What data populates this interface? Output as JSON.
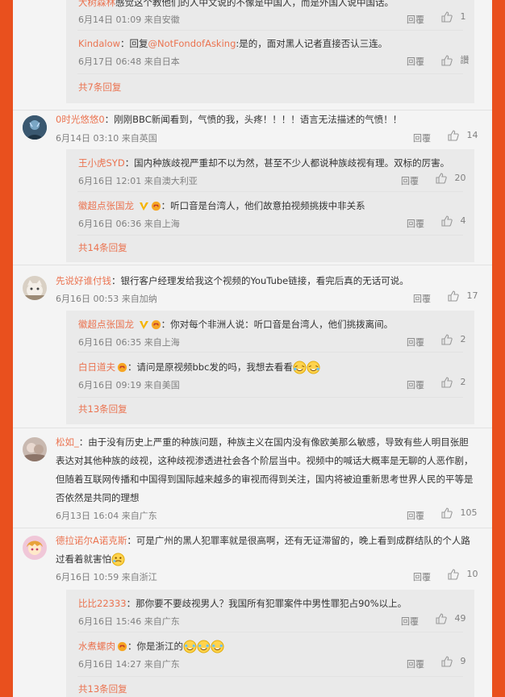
{
  "comments": [
    {
      "partial_text": "感觉这个教他们的人中文说的不像是中国人，而是外国人说中国话。",
      "partial_user": "大树森林",
      "partial_time": "6月14日 01:09 来自安徽",
      "partial_reply": "回覆",
      "partial_likes": "1",
      "replies": [
        {
          "user": "Kindalow",
          "mention": "@NotFondofAsking",
          "text": ":是的，面对黑人记者直接否认三连。",
          "prefix": "：回复",
          "time": "6月17日 06:48 来自日本",
          "reply": "回覆",
          "likes": "讚"
        }
      ],
      "more": "共7条回复"
    },
    {
      "user": "0时光悠悠0",
      "text": "：刚刚BBC新闻看到，气愤的我，头疼！！！！语言无法描述的气愤！！",
      "time": "6月14日 03:10 来自英国",
      "reply": "回覆",
      "likes": "14",
      "replies": [
        {
          "user": "王小虎SYD",
          "text": "：国内种族歧视严重却不以为然，甚至不少人都说种族歧视有理。双标的厉害。",
          "time": "6月16日 12:01 来自澳大利亚",
          "reply": "回覆",
          "likes": "20"
        },
        {
          "user": "徽超点张国龙",
          "text": "：听口音是台湾人，他们故意拍视频挑拨中非关系",
          "time": "6月16日 06:36 来自上海",
          "reply": "回覆",
          "likes": "4"
        }
      ],
      "more": "共14条回复"
    },
    {
      "user": "先说好谁付钱",
      "text": "：银行客户经理发给我这个视频的YouTube链接，看完后真的无话可说。",
      "time": "6月16日 00:53 来自加纳",
      "reply": "回覆",
      "likes": "17",
      "replies": [
        {
          "user": "徽超点张国龙",
          "text": "：你对每个非洲人说：听口音是台湾人，他们挑拨离间。",
          "time": "6月16日 06:35 来自上海",
          "reply": "回覆",
          "likes": "2"
        },
        {
          "user": "白日道夫",
          "text": "：请问是原视频bbc发的吗，我想去看看",
          "time": "6月16日 09:19 来自美国",
          "reply": "回覆",
          "likes": "2"
        }
      ],
      "more": "共13条回复"
    },
    {
      "user": "松如_",
      "text": "：由于没有历史上严重的种族问题，种族主义在国内没有像欧美那么敏感，导致有些人明目张胆表达对其他种族的歧视，这种歧视渗透进社会各个阶层当中。视频中的喊话大概率是无聊的人恶作剧，但随着互联网传播和中国得到国际越来越多的审视而得到关注，国内将被迫重新思考世界人民的平等是否依然是共同的理想",
      "time": "6月13日 16:04 来自广东",
      "reply": "回覆",
      "likes": "105"
    },
    {
      "user": "德拉诺尔A诺克斯",
      "text": "：可是广州的黑人犯罪率就是很高啊，还有无证滞留的，晚上看到成群结队的个人路过看着就害怕",
      "time": "6月16日 10:59 来自浙江",
      "reply": "回覆",
      "likes": "10",
      "replies": [
        {
          "user": "比比22333",
          "text": "：那你要不要歧视男人？我国所有犯罪案件中男性罪犯占90%以上。",
          "time": "6月16日 15:46 来自广东",
          "reply": "回覆",
          "likes": "49"
        },
        {
          "user": "水煮螺肉",
          "text": "：你是浙江的",
          "time": "6月16日 14:27 来自广东",
          "reply": "回覆",
          "likes": "9"
        }
      ],
      "more": "共13条回复"
    }
  ],
  "colors": {
    "accent": "#eb7350",
    "frame": "#e9501e",
    "meta": "#808080"
  },
  "icons": [
    "thumb-up-icon",
    "verified-v-icon",
    "fan-badge-icon",
    "cry-laugh-emoji"
  ]
}
